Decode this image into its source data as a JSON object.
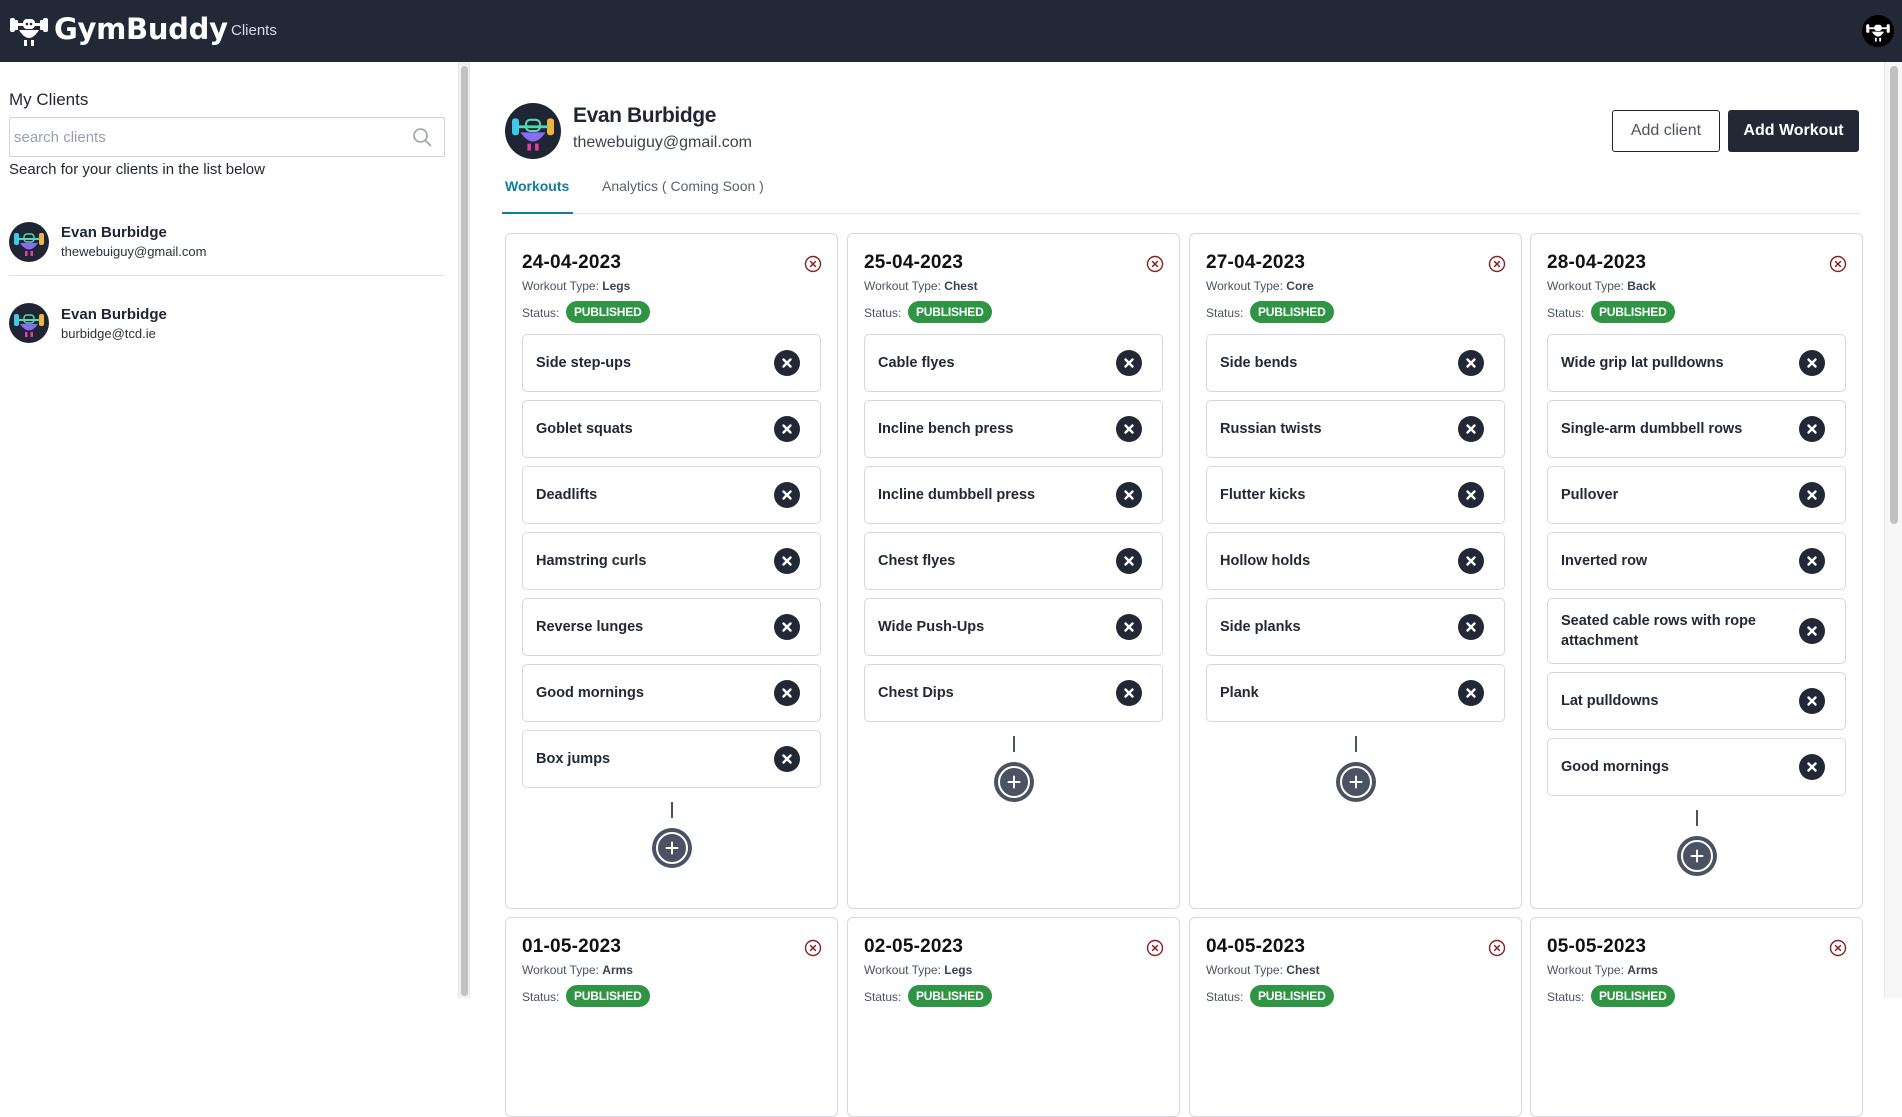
{
  "app": {
    "brand": "GymBuddy",
    "nav": {
      "clients_label": "Clients"
    }
  },
  "sidebar": {
    "title": "My Clients",
    "search": {
      "placeholder": "search clients",
      "value": ""
    },
    "hint": "Search for your clients in the list below",
    "clients": [
      {
        "name": "Evan Burbidge",
        "email": "thewebuiguy@gmail.com"
      },
      {
        "name": "Evan Burbidge",
        "email": "burbidge@tcd.ie"
      }
    ]
  },
  "profile": {
    "name": "Evan Burbidge",
    "email": "thewebuiguy@gmail.com",
    "add_client_label": "Add client",
    "add_workout_label": "Add Workout"
  },
  "tabs": [
    {
      "label": "Workouts",
      "active": true
    },
    {
      "label": "Analytics ( Coming Soon )",
      "active": false
    }
  ],
  "workout_labels": {
    "type_prefix": "Workout Type:",
    "status_prefix": "Status:"
  },
  "colors": {
    "brand_dark": "#222836",
    "accent_tab": "#0e7ea1",
    "status_published": "#2f9444",
    "delete_icon": "#8b1f1f"
  },
  "workouts": [
    {
      "date": "24-04-2023",
      "type": "Legs",
      "status": "PUBLISHED",
      "exercises": [
        "Side step-ups",
        "Goblet squats",
        "Deadlifts",
        "Hamstring curls",
        "Reverse lunges",
        "Good mornings",
        "Box jumps"
      ]
    },
    {
      "date": "25-04-2023",
      "type": "Chest",
      "status": "PUBLISHED",
      "exercises": [
        "Cable flyes",
        "Incline bench press",
        "Incline dumbbell press",
        "Chest flyes",
        "Wide Push-Ups",
        "Chest Dips"
      ]
    },
    {
      "date": "27-04-2023",
      "type": "Core",
      "status": "PUBLISHED",
      "exercises": [
        "Side bends",
        "Russian twists",
        "Flutter kicks",
        "Hollow holds",
        "Side planks",
        "Plank"
      ]
    },
    {
      "date": "28-04-2023",
      "type": "Back",
      "status": "PUBLISHED",
      "exercises": [
        "Wide grip lat pulldowns",
        "Single-arm dumbbell rows",
        "Pullover",
        "Inverted row",
        "Seated cable rows with rope attachment",
        "Lat pulldowns",
        "Good mornings"
      ]
    },
    {
      "date": "01-05-2023",
      "type": "Arms",
      "status": "PUBLISHED",
      "exercises": []
    },
    {
      "date": "02-05-2023",
      "type": "Legs",
      "status": "PUBLISHED",
      "exercises": []
    },
    {
      "date": "04-05-2023",
      "type": "Chest",
      "status": "PUBLISHED",
      "exercises": []
    },
    {
      "date": "05-05-2023",
      "type": "Arms",
      "status": "PUBLISHED",
      "exercises": []
    }
  ]
}
